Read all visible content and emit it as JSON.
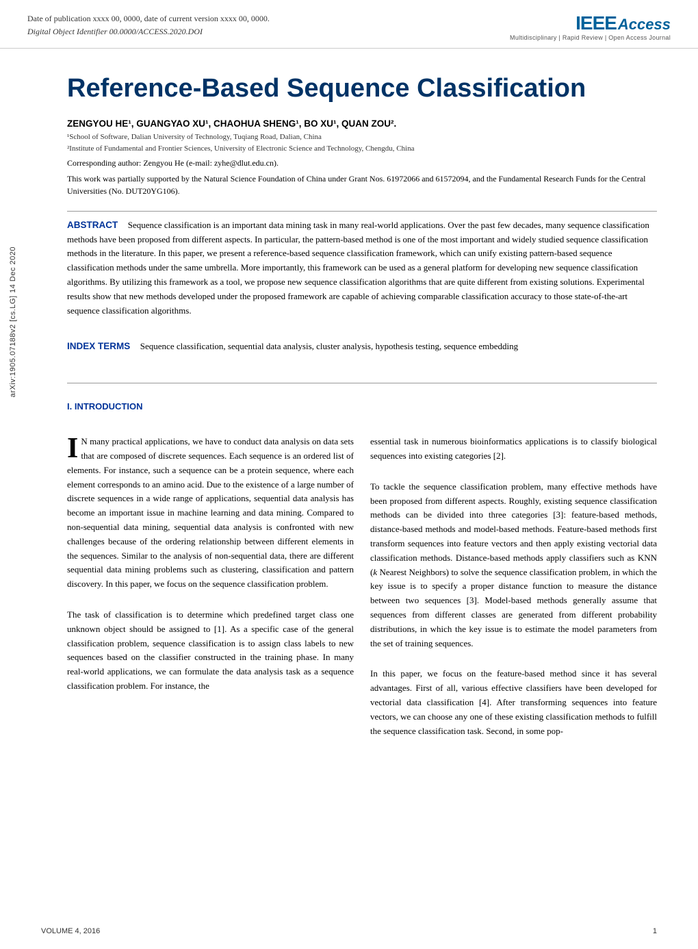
{
  "header": {
    "pub_date": "Date of publication xxxx 00, 0000, date of current version xxxx 00, 0000.",
    "doi": "Digital Object Identifier 00.0000/ACCESS.2020.DOI",
    "ieee_logo": "IEEE Access",
    "ieee_subtitle": "Multidisciplinary | Rapid Review | Open Access Journal"
  },
  "title": "Reference-Based Sequence Classification",
  "authors": {
    "names": "ZENGYOU HE¹, GUANGYAO XU¹, CHAOHUA SHENG¹, BO XU¹, QUAN ZOU².",
    "affiliation1": "¹School of Software, Dalian University of Technology, Tuqiang Road, Dalian, China",
    "affiliation2": "²Institute of Fundamental and Frontier Sciences, University of Electronic Science and Technology, Chengdu, China",
    "corresponding": "Corresponding author: Zengyou He (e-mail: zyhe@dlut.edu.cn).",
    "funding": "This work was partially supported by the Natural Science Foundation of China under Grant Nos. 61972066 and 61572094, and the Fundamental Research Funds for the Central Universities (No. DUT20YG106)."
  },
  "abstract": {
    "label": "ABSTRACT",
    "text": "Sequence classification is an important data mining task in many real-world applications. Over the past few decades, many sequence classification methods have been proposed from different aspects. In particular, the pattern-based method is one of the most important and widely studied sequence classification methods in the literature. In this paper, we present a reference-based sequence classification framework, which can unify existing pattern-based sequence classification methods under the same umbrella. More importantly, this framework can be used as a general platform for developing new sequence classification algorithms. By utilizing this framework as a tool, we propose new sequence classification algorithms that are quite different from existing solutions. Experimental results show that new methods developed under the proposed framework are capable of achieving comparable classification accuracy to those state-of-the-art sequence classification algorithms."
  },
  "index_terms": {
    "label": "INDEX TERMS",
    "text": "Sequence classification, sequential data analysis, cluster analysis, hypothesis testing, sequence embedding"
  },
  "introduction": {
    "label": "I. INTRODUCTION",
    "col_left": [
      "IN many practical applications, we have to conduct data analysis on data sets that are composed of discrete sequences. Each sequence is an ordered list of elements. For instance, such a sequence can be a protein sequence, where each element corresponds to an amino acid. Due to the existence of a large number of discrete sequences in a wide range of applications, sequential data analysis has become an important issue in machine learning and data mining. Compared to non-sequential data mining, sequential data analysis is confronted with new challenges because of the ordering relationship between different elements in the sequences. Similar to the analysis of non-sequential data, there are different sequential data mining problems such as clustering, classification and pattern discovery. In this paper, we focus on the sequence classification problem.",
      "The task of classification is to determine which predefined target class one unknown object should be assigned to [1]. As a specific case of the general classification problem, sequence classification is to assign class labels to new sequences based on the classifier constructed in the training phase. In many real-world applications, we can formulate the data analysis task as a sequence classification problem. For instance, the"
    ],
    "col_right": [
      "essential task in numerous bioinformatics applications is to classify biological sequences into existing categories [2].",
      "To tackle the sequence classification problem, many effective methods have been proposed from different aspects. Roughly, existing sequence classification methods can be divided into three categories [3]: feature-based methods, distance-based methods and model-based methods. Feature-based methods first transform sequences into feature vectors and then apply existing vectorial data classification methods. Distance-based methods apply classifiers such as KNN (k Nearest Neighbors) to solve the sequence classification problem, in which the key issue is to specify a proper distance function to measure the distance between two sequences [3]. Model-based methods generally assume that sequences from different classes are generated from different probability distributions, in which the key issue is to estimate the model parameters from the set of training sequences.",
      "In this paper, we focus on the feature-based method since it has several advantages. First of all, various effective classifiers have been developed for vectorial data classification [4]. After transforming sequences into feature vectors, we can choose any one of these existing classification methods to fulfill the sequence classification task. Second, in some pop-"
    ]
  },
  "arxiv_label": "arXiv:1905.07188v2  [cs.LG]  14 Dec 2020",
  "volume": "VOLUME 4, 2016",
  "page_number": "1"
}
